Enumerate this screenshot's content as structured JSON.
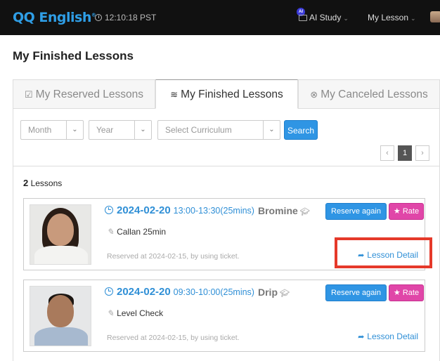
{
  "header": {
    "logo_text": "QQ English",
    "logo_mark": "®",
    "time": "12:10:18 PST",
    "ai_badge": "AI",
    "nav": [
      {
        "label": "AI Study",
        "icon": "graduation-cap-icon"
      },
      {
        "label": "My Lesson"
      }
    ],
    "logo_color": "#2f9ee6",
    "bg_color": "#111111"
  },
  "page": {
    "title": "My Finished Lessons"
  },
  "tabs": [
    {
      "label": "My Reserved Lessons",
      "icon": "calendar-check-icon"
    },
    {
      "label": "My Finished Lessons",
      "icon": "layers-icon",
      "active": true
    },
    {
      "label": "My Canceled Lessons",
      "icon": "times-circle-icon"
    }
  ],
  "filters": {
    "month_placeholder": "Month",
    "year_placeholder": "Year",
    "curriculum_placeholder": "Select Curriculum",
    "search_label": "Search",
    "pagination": {
      "prev": "‹",
      "current": "1",
      "next": "›"
    }
  },
  "lessons_summary": {
    "count": "2",
    "label": "Lessons"
  },
  "lessons": [
    {
      "date": "2024-02-20",
      "time": "13:00-13:30(25mins)",
      "teacher": "Bromine",
      "course": "Callan 25min",
      "reserved_note": "Reserved at 2024-02-15, by using ticket.",
      "reserve_again": "Reserve again",
      "rate": "Rate",
      "detail": "Lesson Detail"
    },
    {
      "date": "2024-02-20",
      "time": "09:30-10:00(25mins)",
      "teacher": "Drip",
      "course": "Level Check",
      "reserved_note": "Reserved at 2024-02-15, by using ticket.",
      "reserve_again": "Reserve again",
      "rate": "Rate",
      "detail": "Lesson Detail"
    }
  ],
  "colors": {
    "accent_blue": "#2f95e4",
    "rate_pink": "#e046a8",
    "highlight_red": "#e5392a"
  }
}
